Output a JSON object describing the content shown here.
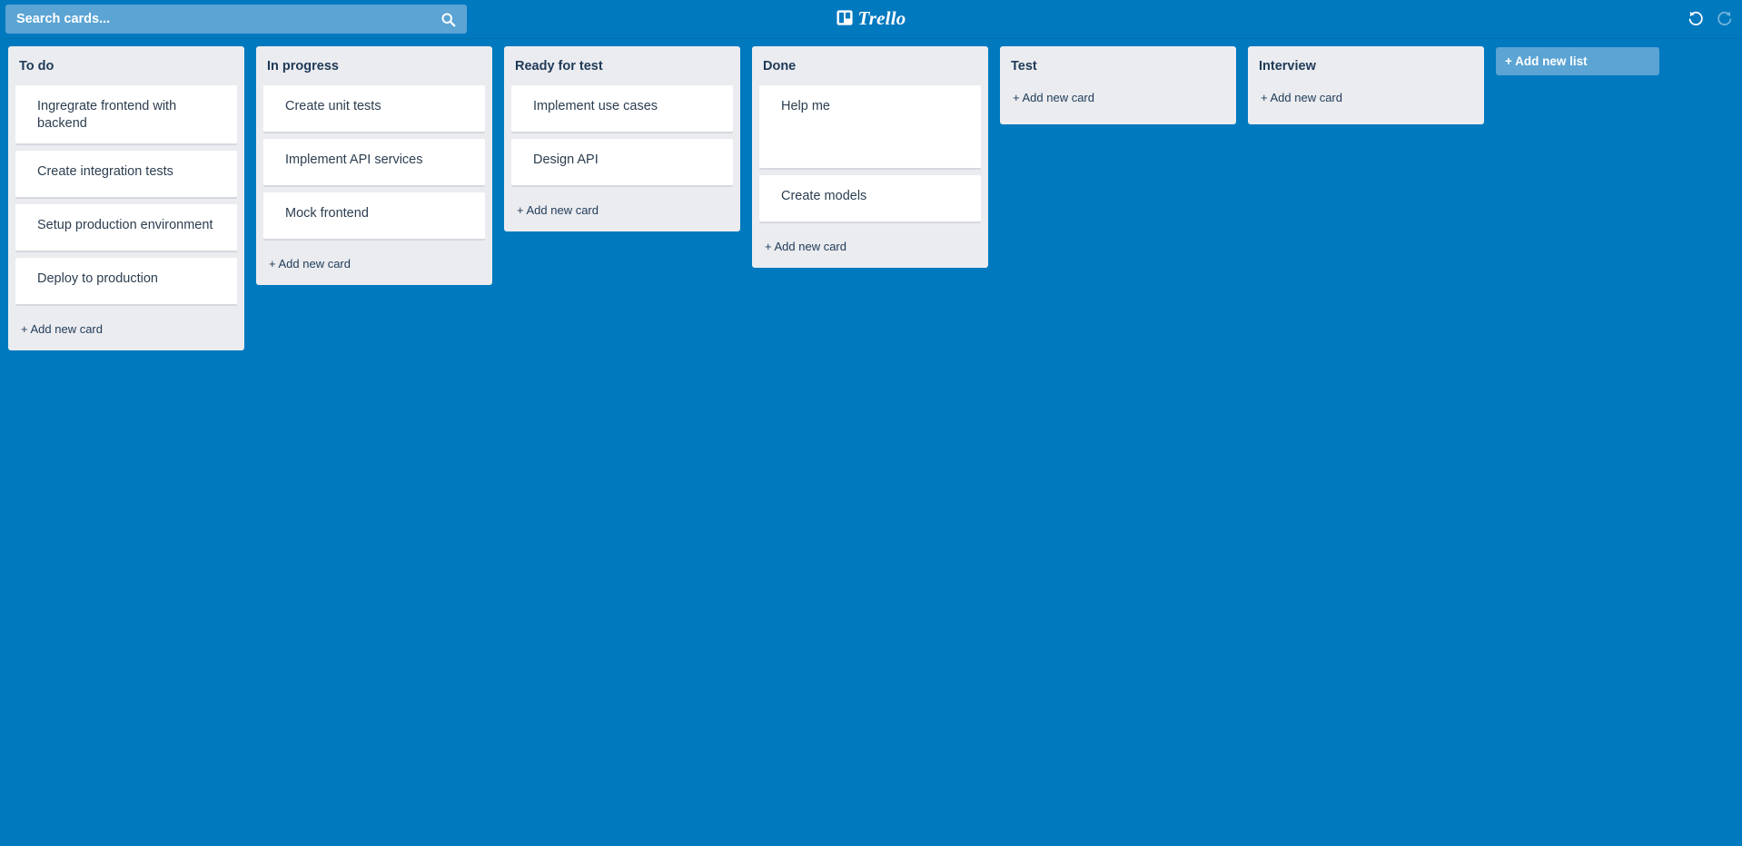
{
  "header": {
    "search": {
      "placeholder": "Search cards...",
      "value": "",
      "icon": "search-icon"
    },
    "brand": {
      "text": "Trello",
      "mark_icon": "trello-board-icon"
    },
    "history": {
      "undo_icon": "undo-arrow-icon",
      "undo_label": "Undo",
      "redo_icon": "redo-arrow-icon",
      "redo_label": "Redo",
      "redo_disabled": true
    }
  },
  "board": {
    "add_list_label": "+ Add new list",
    "add_card_label": "+ Add new card",
    "lists": [
      {
        "title": "To do",
        "cards": [
          {
            "text": "Ingregrate frontend with backend"
          },
          {
            "text": "Create integration tests"
          },
          {
            "text": "Setup production environment"
          },
          {
            "text": "Deploy to production"
          }
        ]
      },
      {
        "title": "In progress",
        "cards": [
          {
            "text": "Create unit tests"
          },
          {
            "text": "Implement API services"
          },
          {
            "text": "Mock frontend"
          }
        ]
      },
      {
        "title": "Ready for test",
        "cards": [
          {
            "text": "Implement use cases"
          },
          {
            "text": "Design API"
          }
        ]
      },
      {
        "title": "Done",
        "cards": [
          {
            "text": "Help me"
          },
          {
            "text": "Create models"
          }
        ]
      },
      {
        "title": "Test",
        "cards": []
      },
      {
        "title": "Interview",
        "cards": []
      }
    ]
  },
  "colors": {
    "board_background": "#0079bf",
    "header_background": "#0079bf",
    "search_background": "#5ba4d4",
    "list_background": "#ebecf0",
    "card_background": "#ffffff",
    "list_title_text": "#1f3a57",
    "card_text": "#2c3e50",
    "add_list_button": "#5ba4d4"
  }
}
